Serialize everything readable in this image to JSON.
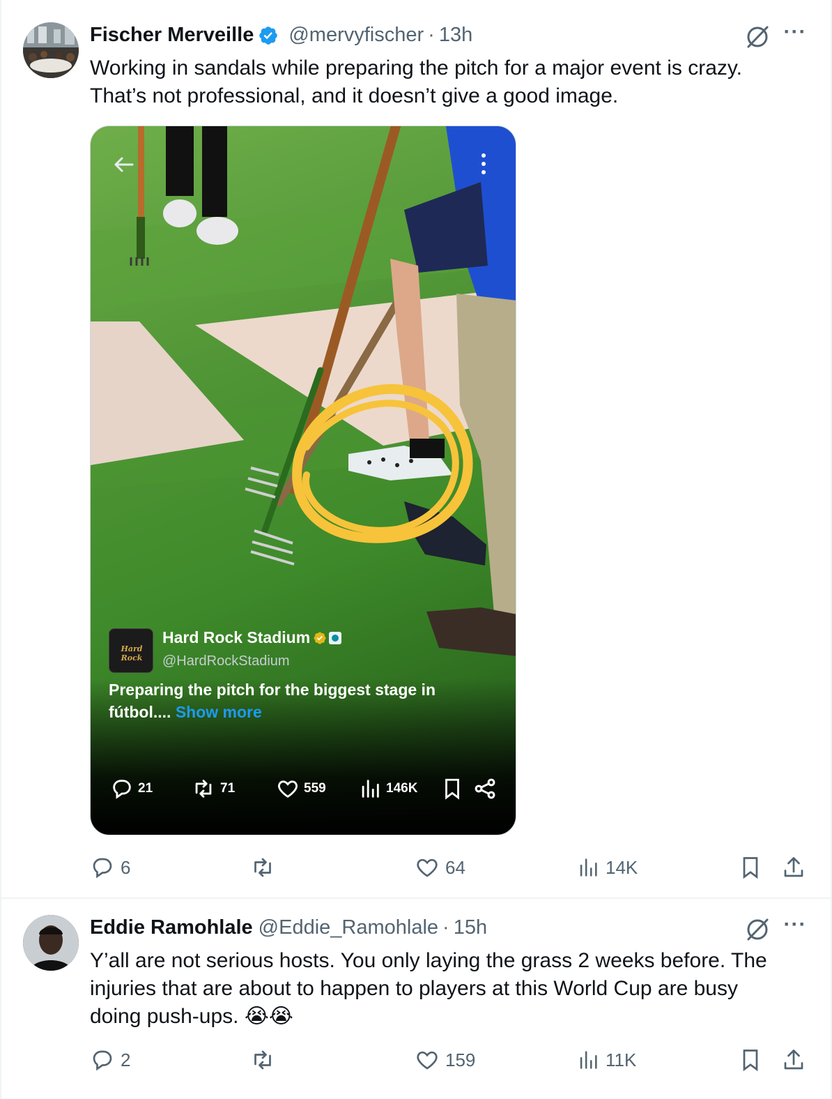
{
  "tweets": [
    {
      "author_name": "Fischer Merveille",
      "handle": "@mervyfischer",
      "separator": "·",
      "time": "13h",
      "text_lines": [
        "Working in sandals while preparing the pitch for a major event is crazy.",
        "That’s not professional, and it doesn’t give a good image."
      ],
      "media": {
        "inner_author_name": "Hard Rock Stadium",
        "inner_handle": "@HardRockStadium",
        "inner_logo_text": "Hard Rock",
        "inner_text_lines": [
          "Preparing the pitch for the biggest stage in",
          "fútbol.... "
        ],
        "inner_link": "Show more",
        "inner_replies": "21",
        "inner_reposts": "71",
        "inner_likes": "559",
        "inner_views": "146K",
        "annotation_color": "#f7c33a"
      },
      "replies": "6",
      "reposts": "",
      "likes": "64",
      "views": "14K"
    },
    {
      "author_name": "Eddie Ramohlale",
      "handle": "@Eddie_Ramohlale",
      "separator": "·",
      "time": "15h",
      "text_lines": [
        "Y’all are not serious hosts. You only laying the grass 2 weeks before. The",
        "injuries that are about to happen to players at this World Cup are busy",
        "doing push-ups. 😭😭"
      ],
      "replies": "2",
      "reposts": "",
      "likes": "159",
      "views": "11K"
    }
  ],
  "icons": {
    "verified": "verified-badge-icon",
    "grok": "grok-icon",
    "more": "more-icon",
    "reply": "reply-icon",
    "repost": "repost-icon",
    "like": "heart-icon",
    "views": "views-icon",
    "bookmark": "bookmark-icon",
    "share": "share-icon"
  },
  "colors": {
    "text": "#0f1419",
    "secondary": "#536471",
    "accent": "#1d9bf0",
    "verified": "#1d9bf0"
  },
  "more_glyph": "···"
}
